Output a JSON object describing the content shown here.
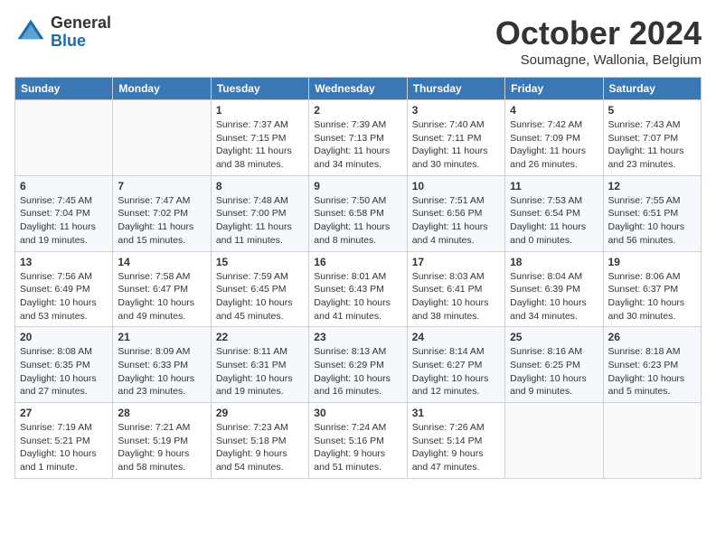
{
  "header": {
    "logo": {
      "general": "General",
      "blue": "Blue"
    },
    "title": "October 2024",
    "location": "Soumagne, Wallonia, Belgium"
  },
  "weekdays": [
    "Sunday",
    "Monday",
    "Tuesday",
    "Wednesday",
    "Thursday",
    "Friday",
    "Saturday"
  ],
  "weeks": [
    [
      {
        "day": "",
        "sunrise": "",
        "sunset": "",
        "daylight": ""
      },
      {
        "day": "",
        "sunrise": "",
        "sunset": "",
        "daylight": ""
      },
      {
        "day": "1",
        "sunrise": "Sunrise: 7:37 AM",
        "sunset": "Sunset: 7:15 PM",
        "daylight": "Daylight: 11 hours and 38 minutes."
      },
      {
        "day": "2",
        "sunrise": "Sunrise: 7:39 AM",
        "sunset": "Sunset: 7:13 PM",
        "daylight": "Daylight: 11 hours and 34 minutes."
      },
      {
        "day": "3",
        "sunrise": "Sunrise: 7:40 AM",
        "sunset": "Sunset: 7:11 PM",
        "daylight": "Daylight: 11 hours and 30 minutes."
      },
      {
        "day": "4",
        "sunrise": "Sunrise: 7:42 AM",
        "sunset": "Sunset: 7:09 PM",
        "daylight": "Daylight: 11 hours and 26 minutes."
      },
      {
        "day": "5",
        "sunrise": "Sunrise: 7:43 AM",
        "sunset": "Sunset: 7:07 PM",
        "daylight": "Daylight: 11 hours and 23 minutes."
      }
    ],
    [
      {
        "day": "6",
        "sunrise": "Sunrise: 7:45 AM",
        "sunset": "Sunset: 7:04 PM",
        "daylight": "Daylight: 11 hours and 19 minutes."
      },
      {
        "day": "7",
        "sunrise": "Sunrise: 7:47 AM",
        "sunset": "Sunset: 7:02 PM",
        "daylight": "Daylight: 11 hours and 15 minutes."
      },
      {
        "day": "8",
        "sunrise": "Sunrise: 7:48 AM",
        "sunset": "Sunset: 7:00 PM",
        "daylight": "Daylight: 11 hours and 11 minutes."
      },
      {
        "day": "9",
        "sunrise": "Sunrise: 7:50 AM",
        "sunset": "Sunset: 6:58 PM",
        "daylight": "Daylight: 11 hours and 8 minutes."
      },
      {
        "day": "10",
        "sunrise": "Sunrise: 7:51 AM",
        "sunset": "Sunset: 6:56 PM",
        "daylight": "Daylight: 11 hours and 4 minutes."
      },
      {
        "day": "11",
        "sunrise": "Sunrise: 7:53 AM",
        "sunset": "Sunset: 6:54 PM",
        "daylight": "Daylight: 11 hours and 0 minutes."
      },
      {
        "day": "12",
        "sunrise": "Sunrise: 7:55 AM",
        "sunset": "Sunset: 6:51 PM",
        "daylight": "Daylight: 10 hours and 56 minutes."
      }
    ],
    [
      {
        "day": "13",
        "sunrise": "Sunrise: 7:56 AM",
        "sunset": "Sunset: 6:49 PM",
        "daylight": "Daylight: 10 hours and 53 minutes."
      },
      {
        "day": "14",
        "sunrise": "Sunrise: 7:58 AM",
        "sunset": "Sunset: 6:47 PM",
        "daylight": "Daylight: 10 hours and 49 minutes."
      },
      {
        "day": "15",
        "sunrise": "Sunrise: 7:59 AM",
        "sunset": "Sunset: 6:45 PM",
        "daylight": "Daylight: 10 hours and 45 minutes."
      },
      {
        "day": "16",
        "sunrise": "Sunrise: 8:01 AM",
        "sunset": "Sunset: 6:43 PM",
        "daylight": "Daylight: 10 hours and 41 minutes."
      },
      {
        "day": "17",
        "sunrise": "Sunrise: 8:03 AM",
        "sunset": "Sunset: 6:41 PM",
        "daylight": "Daylight: 10 hours and 38 minutes."
      },
      {
        "day": "18",
        "sunrise": "Sunrise: 8:04 AM",
        "sunset": "Sunset: 6:39 PM",
        "daylight": "Daylight: 10 hours and 34 minutes."
      },
      {
        "day": "19",
        "sunrise": "Sunrise: 8:06 AM",
        "sunset": "Sunset: 6:37 PM",
        "daylight": "Daylight: 10 hours and 30 minutes."
      }
    ],
    [
      {
        "day": "20",
        "sunrise": "Sunrise: 8:08 AM",
        "sunset": "Sunset: 6:35 PM",
        "daylight": "Daylight: 10 hours and 27 minutes."
      },
      {
        "day": "21",
        "sunrise": "Sunrise: 8:09 AM",
        "sunset": "Sunset: 6:33 PM",
        "daylight": "Daylight: 10 hours and 23 minutes."
      },
      {
        "day": "22",
        "sunrise": "Sunrise: 8:11 AM",
        "sunset": "Sunset: 6:31 PM",
        "daylight": "Daylight: 10 hours and 19 minutes."
      },
      {
        "day": "23",
        "sunrise": "Sunrise: 8:13 AM",
        "sunset": "Sunset: 6:29 PM",
        "daylight": "Daylight: 10 hours and 16 minutes."
      },
      {
        "day": "24",
        "sunrise": "Sunrise: 8:14 AM",
        "sunset": "Sunset: 6:27 PM",
        "daylight": "Daylight: 10 hours and 12 minutes."
      },
      {
        "day": "25",
        "sunrise": "Sunrise: 8:16 AM",
        "sunset": "Sunset: 6:25 PM",
        "daylight": "Daylight: 10 hours and 9 minutes."
      },
      {
        "day": "26",
        "sunrise": "Sunrise: 8:18 AM",
        "sunset": "Sunset: 6:23 PM",
        "daylight": "Daylight: 10 hours and 5 minutes."
      }
    ],
    [
      {
        "day": "27",
        "sunrise": "Sunrise: 7:19 AM",
        "sunset": "Sunset: 5:21 PM",
        "daylight": "Daylight: 10 hours and 1 minute."
      },
      {
        "day": "28",
        "sunrise": "Sunrise: 7:21 AM",
        "sunset": "Sunset: 5:19 PM",
        "daylight": "Daylight: 9 hours and 58 minutes."
      },
      {
        "day": "29",
        "sunrise": "Sunrise: 7:23 AM",
        "sunset": "Sunset: 5:18 PM",
        "daylight": "Daylight: 9 hours and 54 minutes."
      },
      {
        "day": "30",
        "sunrise": "Sunrise: 7:24 AM",
        "sunset": "Sunset: 5:16 PM",
        "daylight": "Daylight: 9 hours and 51 minutes."
      },
      {
        "day": "31",
        "sunrise": "Sunrise: 7:26 AM",
        "sunset": "Sunset: 5:14 PM",
        "daylight": "Daylight: 9 hours and 47 minutes."
      },
      {
        "day": "",
        "sunrise": "",
        "sunset": "",
        "daylight": ""
      },
      {
        "day": "",
        "sunrise": "",
        "sunset": "",
        "daylight": ""
      }
    ]
  ]
}
